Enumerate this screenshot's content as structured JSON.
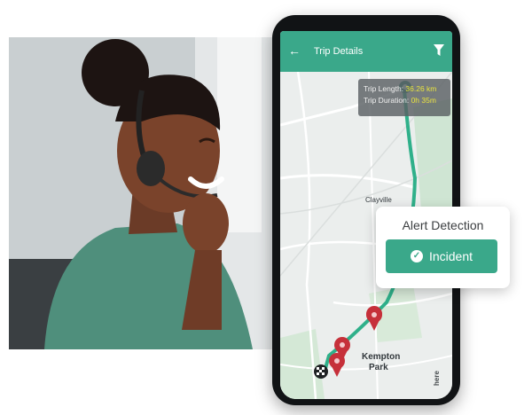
{
  "app": {
    "title": "Trip Details",
    "back_icon": "arrow-left-icon",
    "filter_icon": "filter-icon",
    "accent_color": "#3aa88a"
  },
  "trip": {
    "length_label": "Trip Length:",
    "length_value": "36.26 km",
    "duration_label": "Trip Duration:",
    "duration_value": "0h 35m",
    "value_color": "#e9e43f"
  },
  "map": {
    "places": {
      "clayville": "Clayville",
      "kempton": "Kempton",
      "park": "Park"
    },
    "route_color": "#2fb08a",
    "marker_color": "#c6303a",
    "provider": "here"
  },
  "alert": {
    "heading": "Alert Detection",
    "button_label": "Incident",
    "button_icon": "check-circle-icon"
  }
}
